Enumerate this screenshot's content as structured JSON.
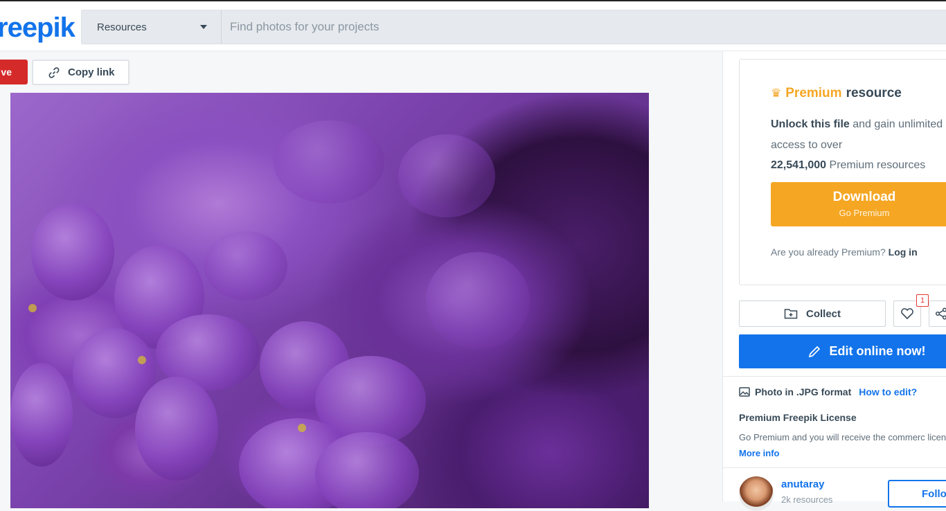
{
  "header": {
    "logo_text": "reepik",
    "search_type": "Resources",
    "search_placeholder": "Find photos for your projects"
  },
  "toolbar": {
    "save_label": "ve",
    "copy_link_label": "Copy link"
  },
  "premium": {
    "title_highlight": "Premium",
    "title_rest": "resource",
    "unlock_bold": "Unlock this file",
    "unlock_rest": "and gain unlimited access to over",
    "count": "22,541,000",
    "count_rest": "Premium resources",
    "download_label": "Download",
    "download_sub": "Go Premium",
    "login_prompt": "Are you already Premium?",
    "login_link": "Log in"
  },
  "actions": {
    "collect_label": "Collect",
    "like_count": "1",
    "edit_label": "Edit online now!"
  },
  "info": {
    "format_label": "Photo in .JPG format",
    "how_to_edit": "How to edit?",
    "license_title": "Premium Freepik License",
    "license_text": "Go Premium and you will receive the commerc license.",
    "more_info": "More info"
  },
  "author": {
    "name": "anutaray",
    "resources": "2k resources",
    "follow_label": "Follo"
  },
  "colors": {
    "brand_blue": "#1273eb",
    "premium_orange": "#f5a623",
    "save_red": "#d52a2a"
  }
}
